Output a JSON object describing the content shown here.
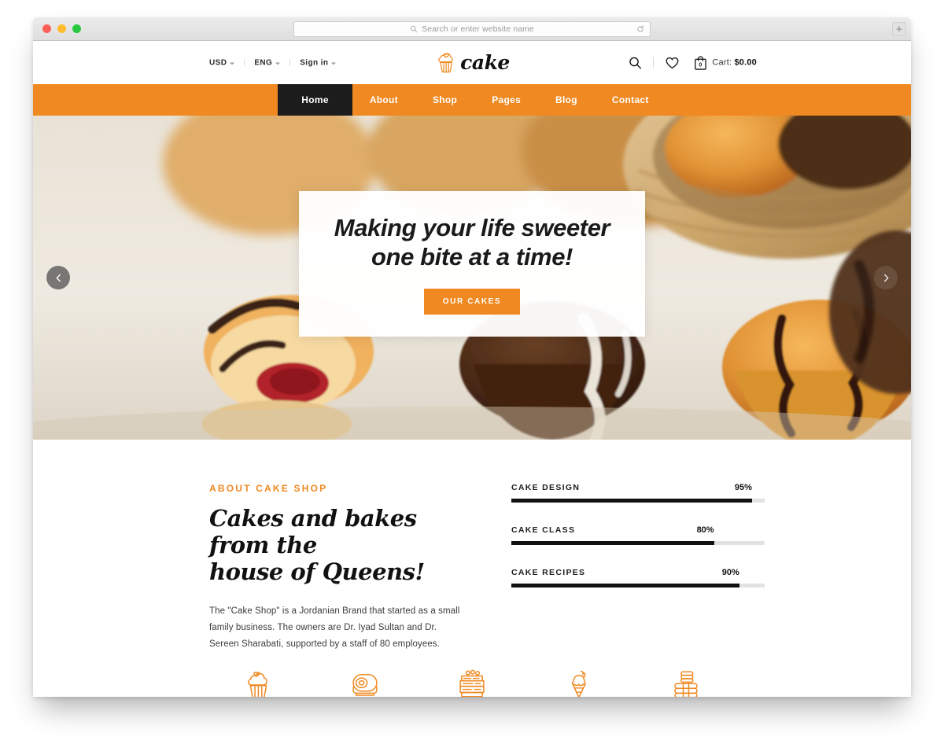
{
  "browser": {
    "address_placeholder": "Search or enter website name",
    "search_icon": "search-icon",
    "reload_icon": "reload-icon",
    "newtab_label": "+",
    "traffic_lights": [
      "close",
      "minimize",
      "maximize"
    ]
  },
  "header": {
    "utility": [
      {
        "label": "USD",
        "has_caret": true
      },
      {
        "label": "ENG",
        "has_caret": true
      },
      {
        "label": "Sign in",
        "has_caret": true
      }
    ],
    "separator": "|",
    "brand": {
      "wordmark": "cake",
      "icon": "cupcake-icon"
    },
    "actions": {
      "search_icon": "search-icon",
      "wishlist_icon": "heart-icon",
      "bag_icon": "shopping-bag-icon",
      "bag_count": "0",
      "cart_prefix": "Cart: ",
      "cart_total": "$0.00"
    }
  },
  "nav": {
    "items": [
      {
        "label": "Home",
        "active": true
      },
      {
        "label": "About",
        "active": false
      },
      {
        "label": "Shop",
        "active": false
      },
      {
        "label": "Pages",
        "active": false
      },
      {
        "label": "Blog",
        "active": false
      },
      {
        "label": "Contact",
        "active": false
      }
    ]
  },
  "hero": {
    "title_line1": "Making your life sweeter",
    "title_line2": "one bite at a time!",
    "cta_label": "OUR CAKES",
    "prev_icon": "chevron-left-icon",
    "next_icon": "chevron-right-icon"
  },
  "about": {
    "eyebrow": "ABOUT CAKE SHOP",
    "heading_line1": "Cakes and bakes from the",
    "heading_line2": "house of Queens!",
    "body": "The \"Cake Shop\" is a Jordanian Brand that started as a small family business. The owners are Dr. Iyad Sultan and Dr. Sereen Sharabati, supported by a staff of 80 employees."
  },
  "skills": [
    {
      "label": "CAKE DESIGN",
      "percent_label": "95%",
      "percent": 95
    },
    {
      "label": "CAKE CLASS",
      "percent_label": "80%",
      "percent": 80
    },
    {
      "label": "CAKE RECIPES",
      "percent_label": "90%",
      "percent": 90
    }
  ],
  "category_icons": [
    {
      "name": "cupcake-icon"
    },
    {
      "name": "cake-roll-icon"
    },
    {
      "name": "layer-cake-icon"
    },
    {
      "name": "ice-cream-cone-icon"
    },
    {
      "name": "macaron-stack-icon"
    }
  ],
  "colors": {
    "accent_orange": "#F08921",
    "nav_active_bg": "#1c1c1c",
    "progress_fill": "#111111",
    "progress_track": "#e2e2e2",
    "heading_text": "#111111"
  }
}
